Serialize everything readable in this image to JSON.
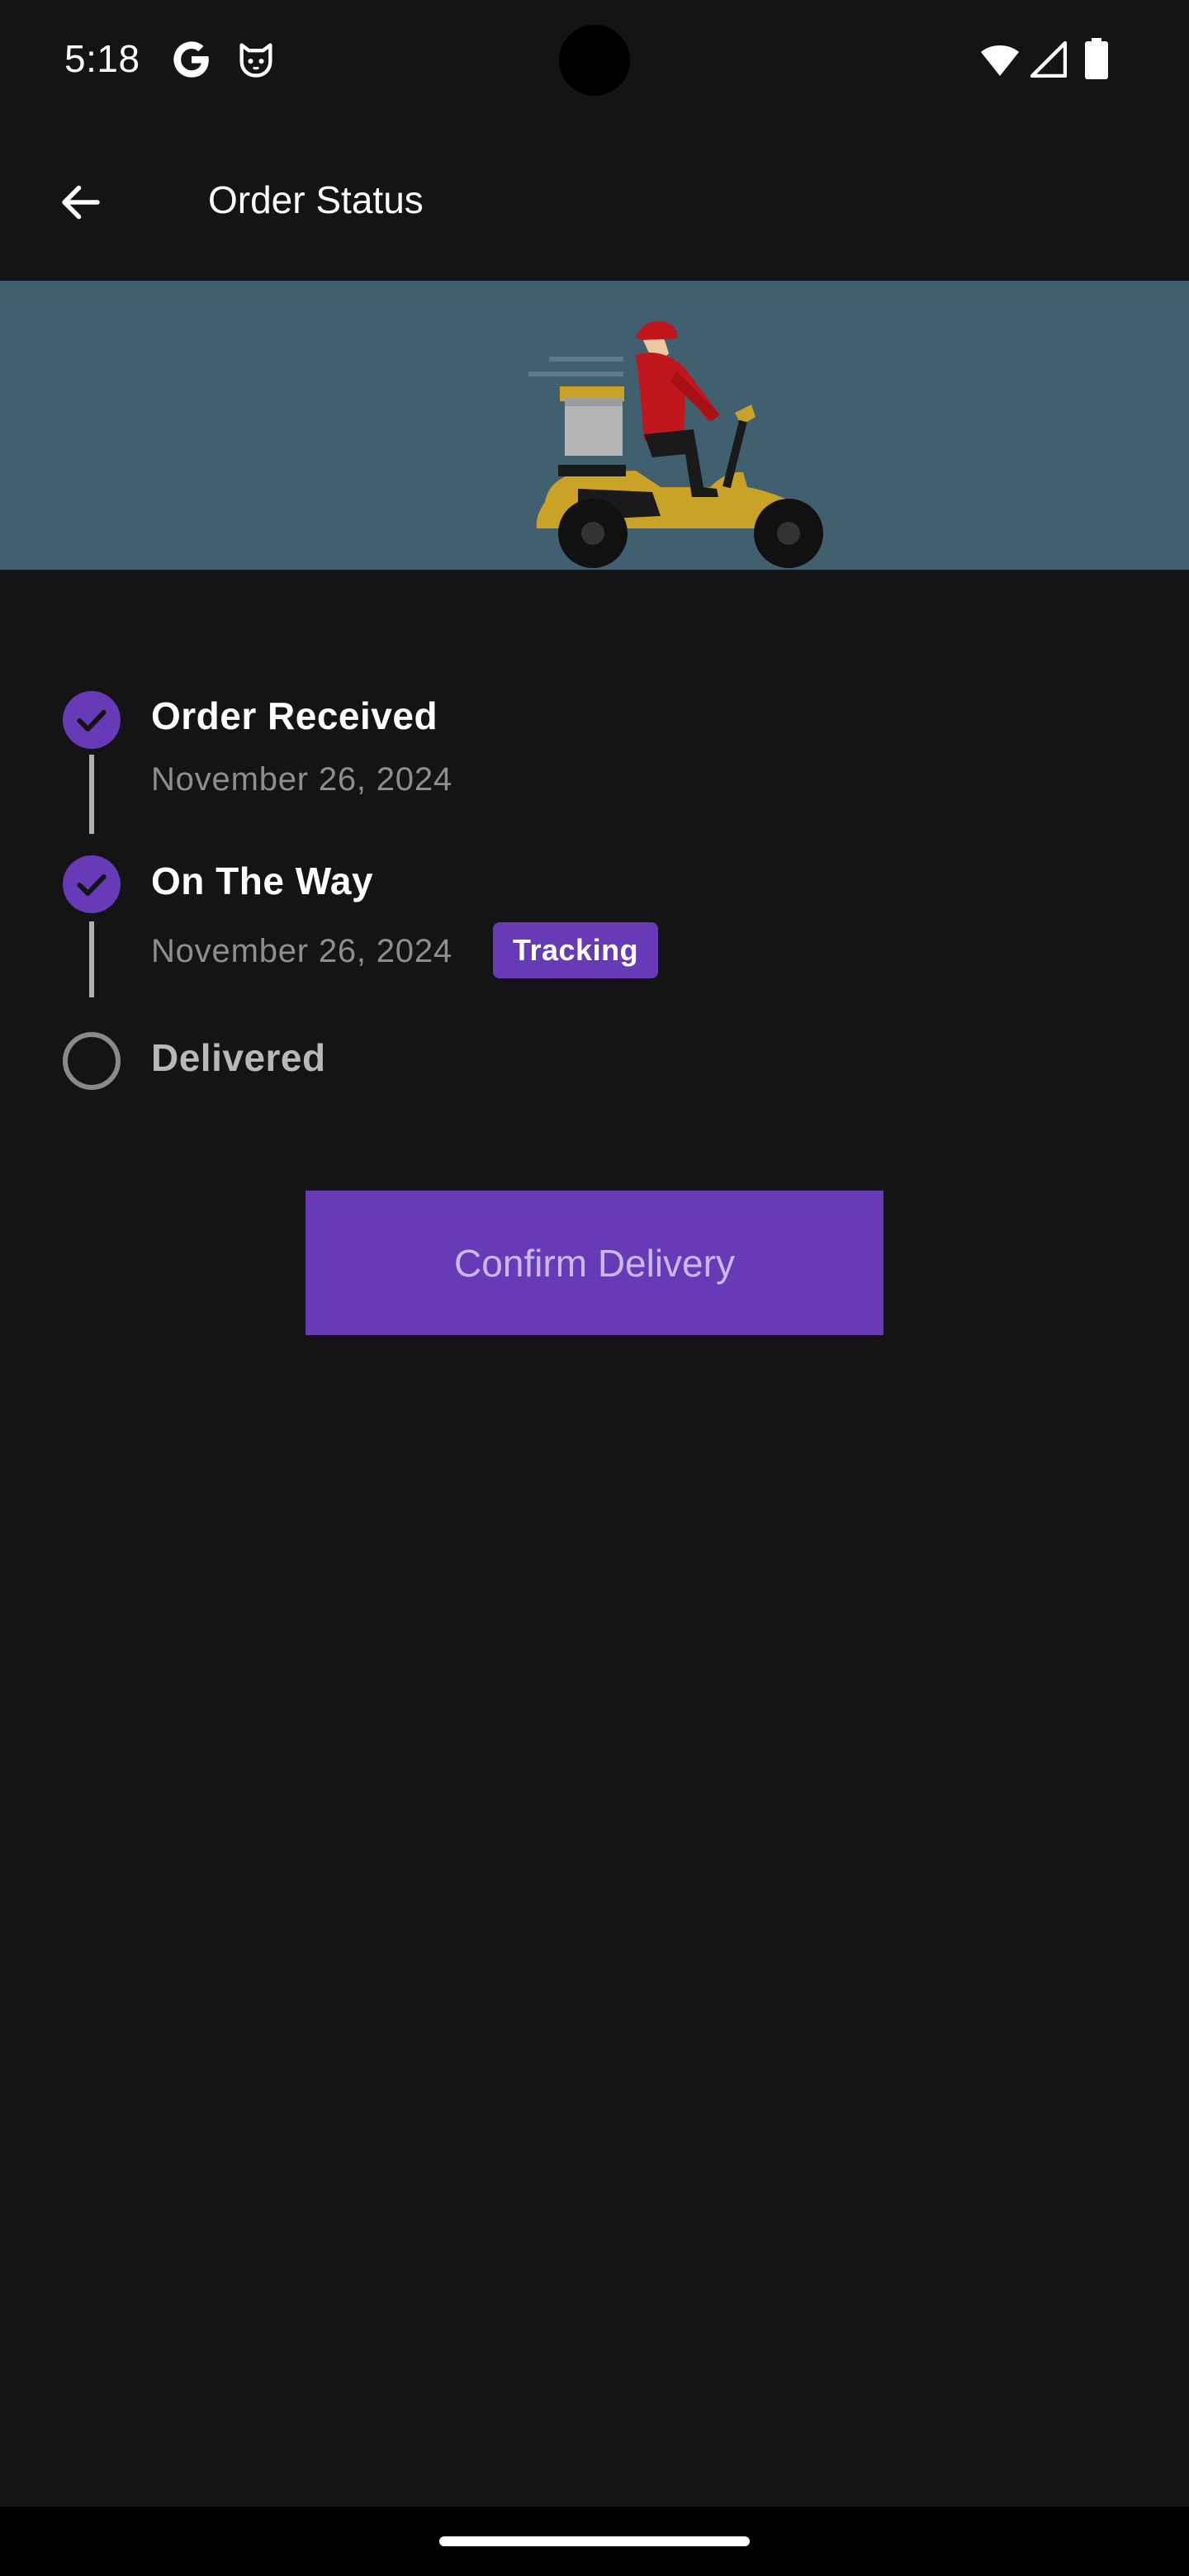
{
  "status_bar": {
    "time": "5:18",
    "icons": [
      "google-g-icon",
      "cat-face-icon",
      "wifi-icon",
      "cell-signal-icon",
      "battery-icon"
    ]
  },
  "app_bar": {
    "title": "Order Status",
    "back_icon": "arrow-left-icon"
  },
  "banner": {
    "illustration": "delivery-scooter-rider",
    "background_color": "#41606f"
  },
  "timeline": {
    "steps": [
      {
        "title": "Order Received",
        "date": "November 26, 2024",
        "completed": true
      },
      {
        "title": "On The Way",
        "date": "November 26, 2024",
        "completed": true,
        "badge": "Tracking"
      },
      {
        "title": "Delivered",
        "completed": false
      }
    ]
  },
  "actions": {
    "confirm_label": "Confirm Delivery"
  },
  "colors": {
    "accent": "#673ab7",
    "background": "#141414",
    "muted_text": "#8e8e8e"
  }
}
